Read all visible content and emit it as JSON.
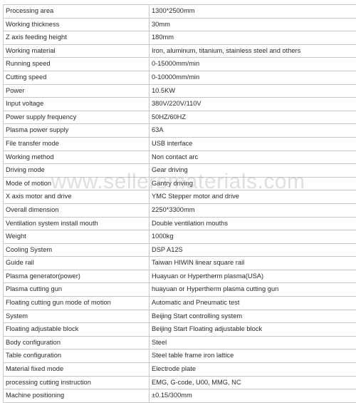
{
  "watermark": {
    "text": "www.sellersmaterials.com"
  },
  "table": {
    "rows": [
      {
        "label": "Processing area",
        "value": "1300*2500mm"
      },
      {
        "label": "Working thickness",
        "value": "30mm"
      },
      {
        "label": "Z axis feeding height",
        "value": "180mm"
      },
      {
        "label": "Working material",
        "value": "Iron, aluminum, titanium, stainless steel and others"
      },
      {
        "label": "Running speed",
        "value": "0-15000mm/min"
      },
      {
        "label": "Cutting speed",
        "value": "0-10000mm/min"
      },
      {
        "label": "Power",
        "value": "10.5KW"
      },
      {
        "label": "Input voltage",
        "value": "380V/220V/110V"
      },
      {
        "label": "Power supply frequency",
        "value": "50HZ/60HZ"
      },
      {
        "label": "Plasma power supply",
        "value": "63A"
      },
      {
        "label": "File transfer mode",
        "value": "USB interface"
      },
      {
        "label": "Working method",
        "value": "Non contact arc"
      },
      {
        "label": "Driving mode",
        "value": "Gear driving"
      },
      {
        "label": "Mode of motion",
        "value": "Gantry driving"
      },
      {
        "label": "X axis motor and drive",
        "value": "YMC Stepper motor and drive"
      },
      {
        "label": "Overall dimension",
        "value": "2250*3300mm"
      },
      {
        "label": "Ventilation system install mouth",
        "value": "Double ventilation mouths"
      },
      {
        "label": "Weight",
        "value": "1000kg"
      },
      {
        "label": "Cooling System",
        "value": "DSP A12S"
      },
      {
        "label": "Guide rail",
        "value": "Taiwan HIWIN linear square rail"
      },
      {
        "label": "Plasma generator(power)",
        "value": "Huayuan or Hypertherm plasma(USA)"
      },
      {
        "label": "Plasma cutting gun",
        "value": "huayuan or Hypertherm plasma cutting gun"
      },
      {
        "label": "Floating cutting gun mode of motion",
        "value": "Automatic and Pneumatic test"
      },
      {
        "label": "System",
        "value": "Beijing Start controlling system"
      },
      {
        "label": "Floating adjustable block",
        "value": "Beijing Start Floating adjustable block"
      },
      {
        "label": "Body configuration",
        "value": "Steel"
      },
      {
        "label": "Table configuration",
        "value": "Steel table frame iron lattice"
      },
      {
        "label": "Material fixed mode",
        "value": "Electrode plate"
      },
      {
        "label": "processing cutting instruction",
        "value": "EMG, G-code, U00, MMG, NC"
      },
      {
        "label": "Machine positioning",
        "value": "±0.15/300mm"
      }
    ]
  }
}
